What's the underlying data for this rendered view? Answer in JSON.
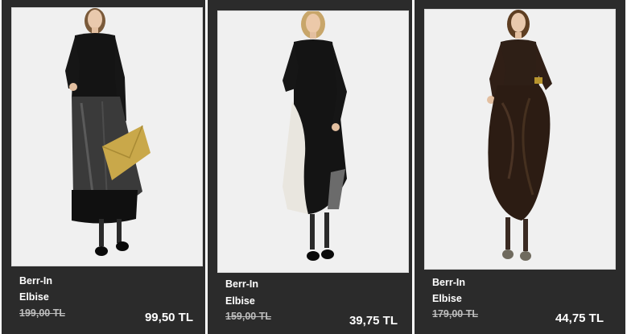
{
  "products": [
    {
      "brand": "Berr-In",
      "type": "Elbise",
      "old_price": "199,00 TL",
      "new_price": "99,50 TL",
      "image": "model-black-satin-dress-gold-clutch"
    },
    {
      "brand": "Berr-In",
      "type": "Elbise",
      "old_price": "159,00 TL",
      "new_price": "39,75 TL",
      "image": "model-black-white-long-dress"
    },
    {
      "brand": "Berr-In",
      "type": "Elbise",
      "old_price": "179,00 TL",
      "new_price": "44,75 TL",
      "image": "model-brown-draped-dress"
    }
  ],
  "colors": {
    "card_background": "#2b2b2b",
    "photo_background": "#ededed",
    "text": "#ffffff",
    "old_price": "#bdbdbd"
  }
}
